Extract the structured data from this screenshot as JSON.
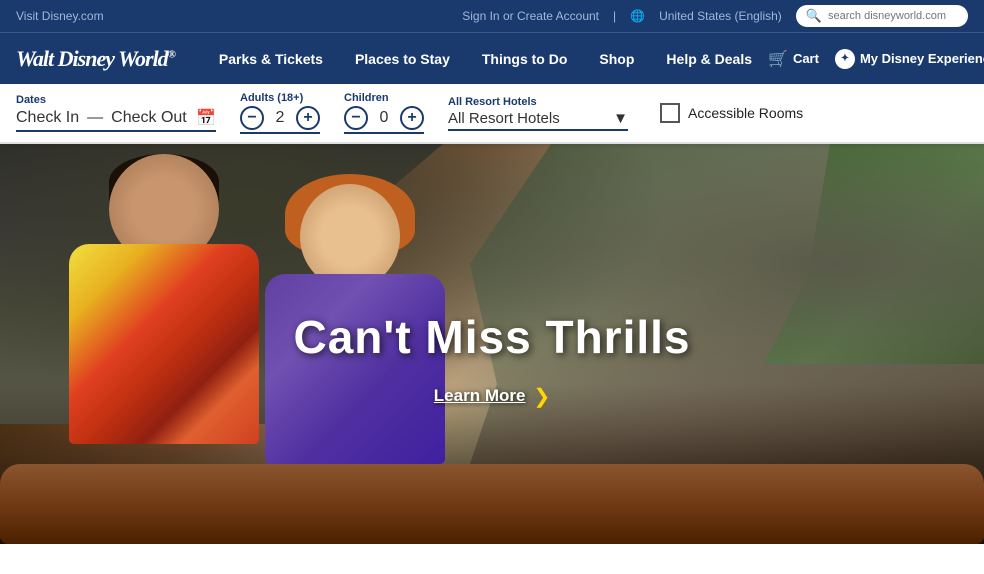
{
  "topbar": {
    "visit_link": "Visit Disney.com",
    "signin_link": "Sign In or Create Account",
    "divider": "|",
    "globe_icon": "🌐",
    "region": "United States (English)",
    "search_placeholder": "search disneyworld.com"
  },
  "navbar": {
    "logo": "Walt Disney World",
    "logo_reg": "®",
    "nav_items": [
      {
        "label": "Parks & Tickets"
      },
      {
        "label": "Places to Stay"
      },
      {
        "label": "Things to Do"
      },
      {
        "label": "Shop"
      },
      {
        "label": "Help & Deals"
      }
    ],
    "cart_label": "Cart",
    "my_disney_label": "My Disney Experience"
  },
  "filterbar": {
    "dates_label": "Dates",
    "checkin_label": "Check In",
    "dash": "—",
    "checkout_label": "Check Out",
    "adults_label": "Adults (18+)",
    "adults_value": "2",
    "children_label": "Children",
    "children_value": "0",
    "resort_label": "All Resort Hotels",
    "resort_value": "All Resort Hotels",
    "accessible_label": "Accessible Rooms"
  },
  "hero": {
    "title": "Can't Miss Thrills",
    "cta_label": "Learn More",
    "cta_arrow": "❯"
  }
}
